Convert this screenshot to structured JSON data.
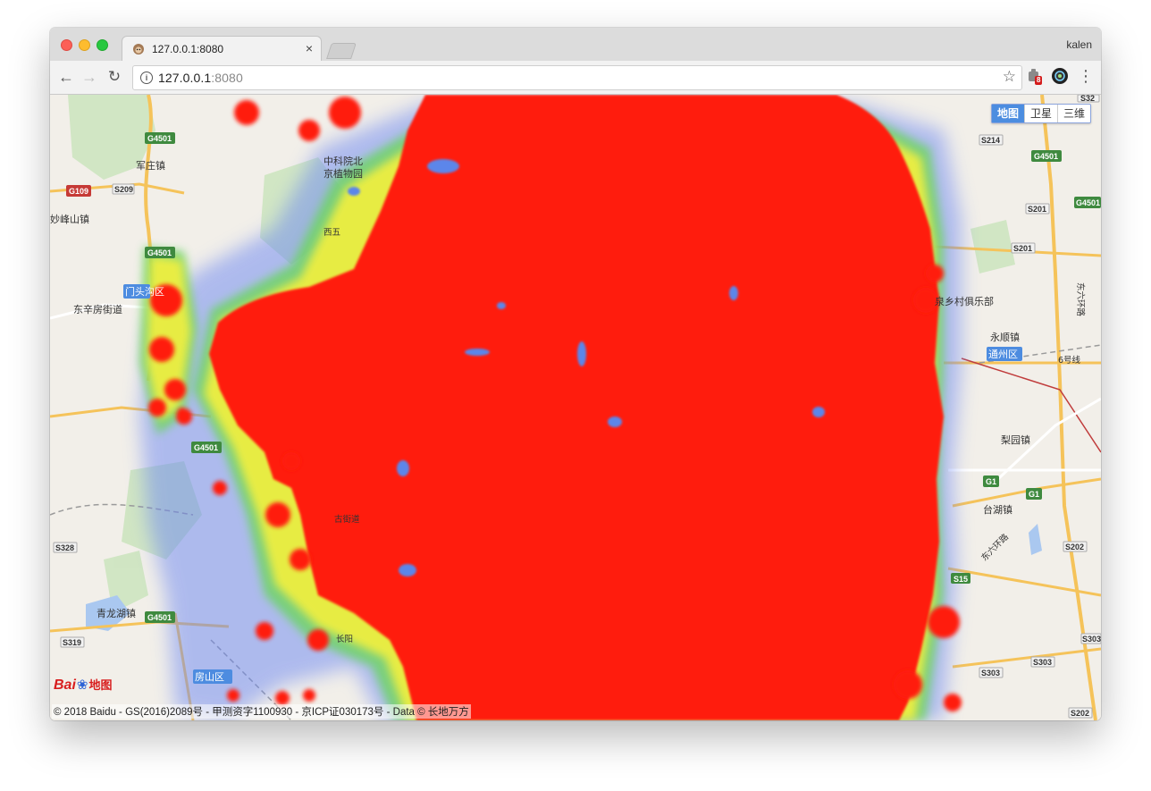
{
  "browser": {
    "tab_title": "127.0.0.1:8080",
    "tab_close": "×",
    "profile_name": "kalen",
    "url_host": "127.0.0.1",
    "url_port": ":8080",
    "ext_badge": "8"
  },
  "map": {
    "type_buttons": [
      "地图",
      "卫星",
      "三维"
    ],
    "active_type": "地图",
    "copyright": "© 2018 Baidu - GS(2016)2089号 - 甲测资字1100930 - 京ICP证030173号 - Data © 长地万方",
    "logo_text": "Bai",
    "logo_suffix": "地图",
    "place_labels": {
      "junzhuang": "军庄镇",
      "miaofengshan": "妙峰山镇",
      "dongxinfang": "东辛房街道",
      "mentou": "门头沟区",
      "qinglongzhen": "青龙湖镇",
      "fangshan": "房山区",
      "zhongkeyuan": "中科院北",
      "jingzhiwu": "京植物园",
      "yongshun": "永顺镇",
      "tongzhou": "通州区",
      "liyuan": "梨园镇",
      "taihu": "台湖镇",
      "luocun": "泉乡村俱乐部",
      "dongliuhuan": "东六环路",
      "dongliuhuan2": "东六环路",
      "liuhao": "6号线",
      "changyang": "长阳",
      "gujiedao": "古街道",
      "xiwu": "西五"
    },
    "road_badges": {
      "g4501_a": "G4501",
      "g4501_b": "G4501",
      "g4501_c": "G4501",
      "g4501_d": "G4501",
      "g4501_e": "G4501",
      "g4501_f": "G4501",
      "g109": "G109",
      "s209": "S209",
      "s214": "S214",
      "s201a": "S201",
      "s201b": "S201",
      "s328": "S328",
      "s319": "S319",
      "s15": "S15",
      "s202": "S202",
      "s303a": "S303",
      "s303b": "S303",
      "s303c": "S303",
      "s202b": "S202",
      "g1a": "G1",
      "g1b": "G1",
      "s32": "S32"
    },
    "colors": {
      "heat_core": "#ff1a10",
      "heat_mid": "#f2f23a",
      "heat_edge": "#3cc46a",
      "heat_outer": "#5a78f0",
      "road_highway": "#f5c35a",
      "badge_green": "#3f8a3f"
    }
  }
}
